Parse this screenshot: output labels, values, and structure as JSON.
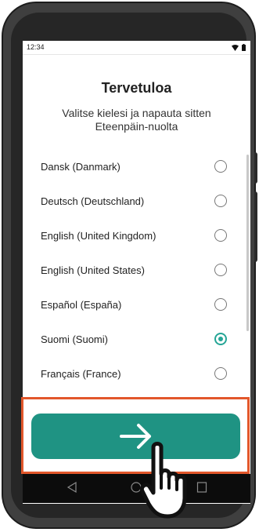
{
  "status_bar": {
    "time": "12:34",
    "icons": [
      "wifi-icon",
      "battery-icon"
    ]
  },
  "welcome": {
    "title": "Tervetuloa",
    "subtitle": "Valitse kielesi ja napauta sitten Eteenpäin-nuolta"
  },
  "languages": [
    {
      "label": "Dansk (Danmark)",
      "selected": false
    },
    {
      "label": "Deutsch (Deutschland)",
      "selected": false
    },
    {
      "label": "English (United Kingdom)",
      "selected": false
    },
    {
      "label": "English (United States)",
      "selected": false
    },
    {
      "label": "Español (España)",
      "selected": false
    },
    {
      "label": "Suomi (Suomi)",
      "selected": true
    },
    {
      "label": "Français (France)",
      "selected": false
    }
  ],
  "next_button": {
    "icon": "arrow-right-icon"
  },
  "nav_bar": {
    "icons": [
      "back-icon",
      "home-icon",
      "recents-icon"
    ]
  },
  "overlay": {
    "icon": "pointer-hand-icon"
  },
  "colors": {
    "accent": "#1f9383",
    "radio_selected": "#25a596",
    "highlight": "#e2572b"
  }
}
